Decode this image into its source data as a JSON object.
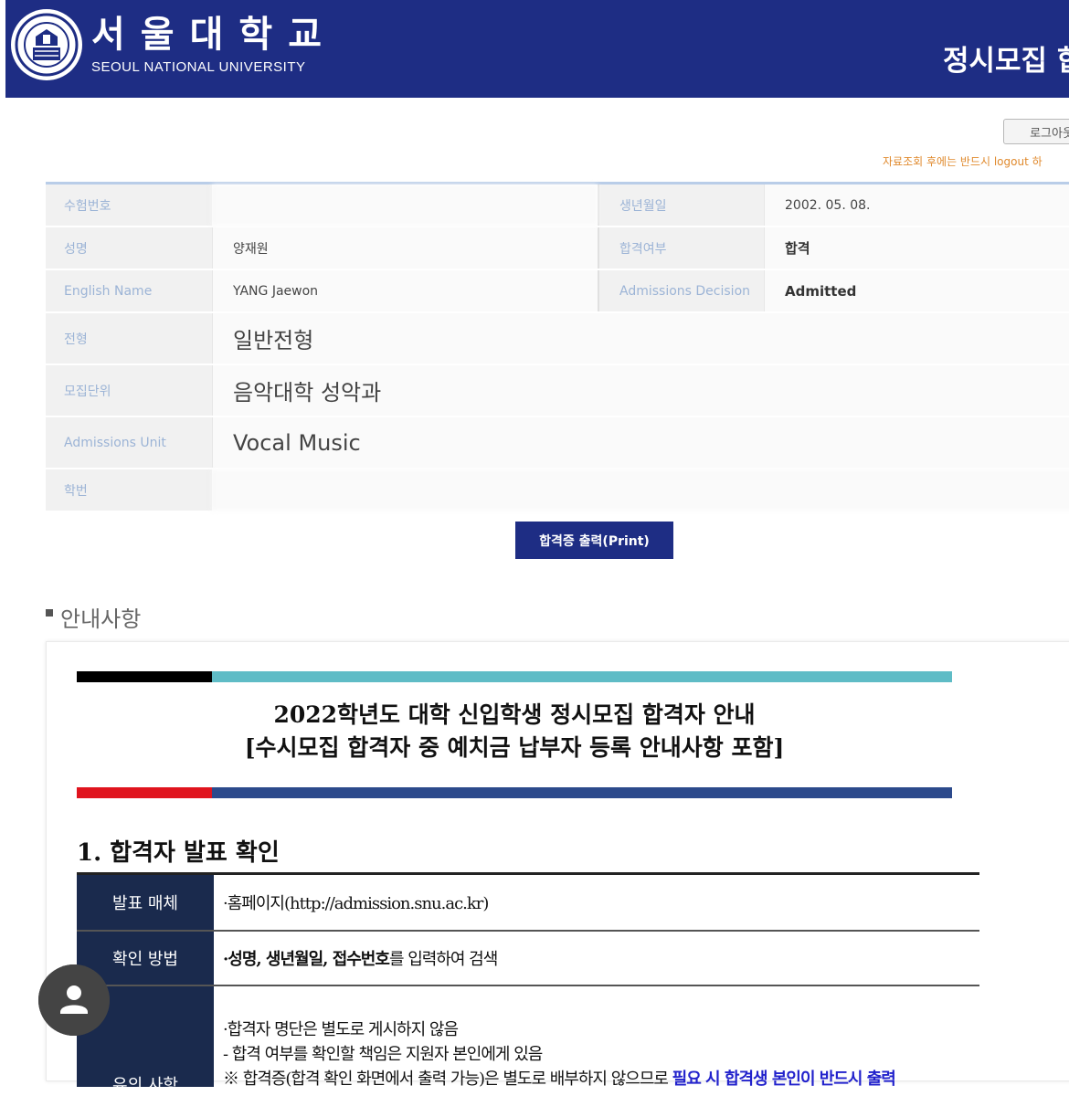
{
  "header": {
    "logo_ko": "서울대학교",
    "logo_en": "SEOUL NATIONAL UNIVERSITY",
    "title": "정시모집 합"
  },
  "logout": {
    "label": "로그아웃",
    "note": "자료조회 후에는 반드시 logout 하"
  },
  "info": {
    "exam_no_label": "수험번호",
    "exam_no_value": "",
    "birth_label": "생년월일",
    "birth_value": "2002. 05. 08.",
    "name_label": "성명",
    "name_value": "양재원",
    "result_label": "합격여부",
    "result_value": "합격",
    "en_name_label": "English Name",
    "en_name_value": "YANG Jaewon",
    "decision_label": "Admissions Decision",
    "decision_value": "Admitted",
    "type_label": "전형",
    "type_value": "일반전형",
    "unit_label": "모집단위",
    "unit_value": "음악대학 성악과",
    "unit_en_label": "Admissions Unit",
    "unit_en_value": "Vocal Music",
    "student_id_label": "학번",
    "student_id_value": ""
  },
  "print_button": "합격증 출력(Print)",
  "notice": {
    "heading": "안내사항",
    "title_line1": "2022학년도 대학 신입학생 정시모집 합격자 안내",
    "title_line2": "[수시모집 합격자 중 예치금 납부자 등록 안내사항 포함]",
    "section1": "1. 합격자 발표 확인",
    "rows": [
      {
        "label": "발표 매체",
        "value": "·홈페이지(http://admission.snu.ac.kr)"
      },
      {
        "label": "확인 방법",
        "value_bold": "·성명, 생년월일, 접수번호",
        "value_rest": "를 입력하여 검색"
      }
    ],
    "caution_label": "유의 사항",
    "caution_lines": [
      "·합격자 명단은 별도로 게시하지 않음",
      "- 합격 여부를 확인할 책임은 지원자 본인에게 있음"
    ],
    "caution_line3_start": "※ 합격증(합격 확인 화면에서 출력 가능)은 별도로 배부하지 않으므로 ",
    "caution_line3_blue": "필요 시 합격생 본인이 반드시 출력"
  },
  "colors": {
    "header_bg": "#1e2d84",
    "table_label_text": "#9cb4d6",
    "notice_label_bg": "#1a2a4d"
  }
}
